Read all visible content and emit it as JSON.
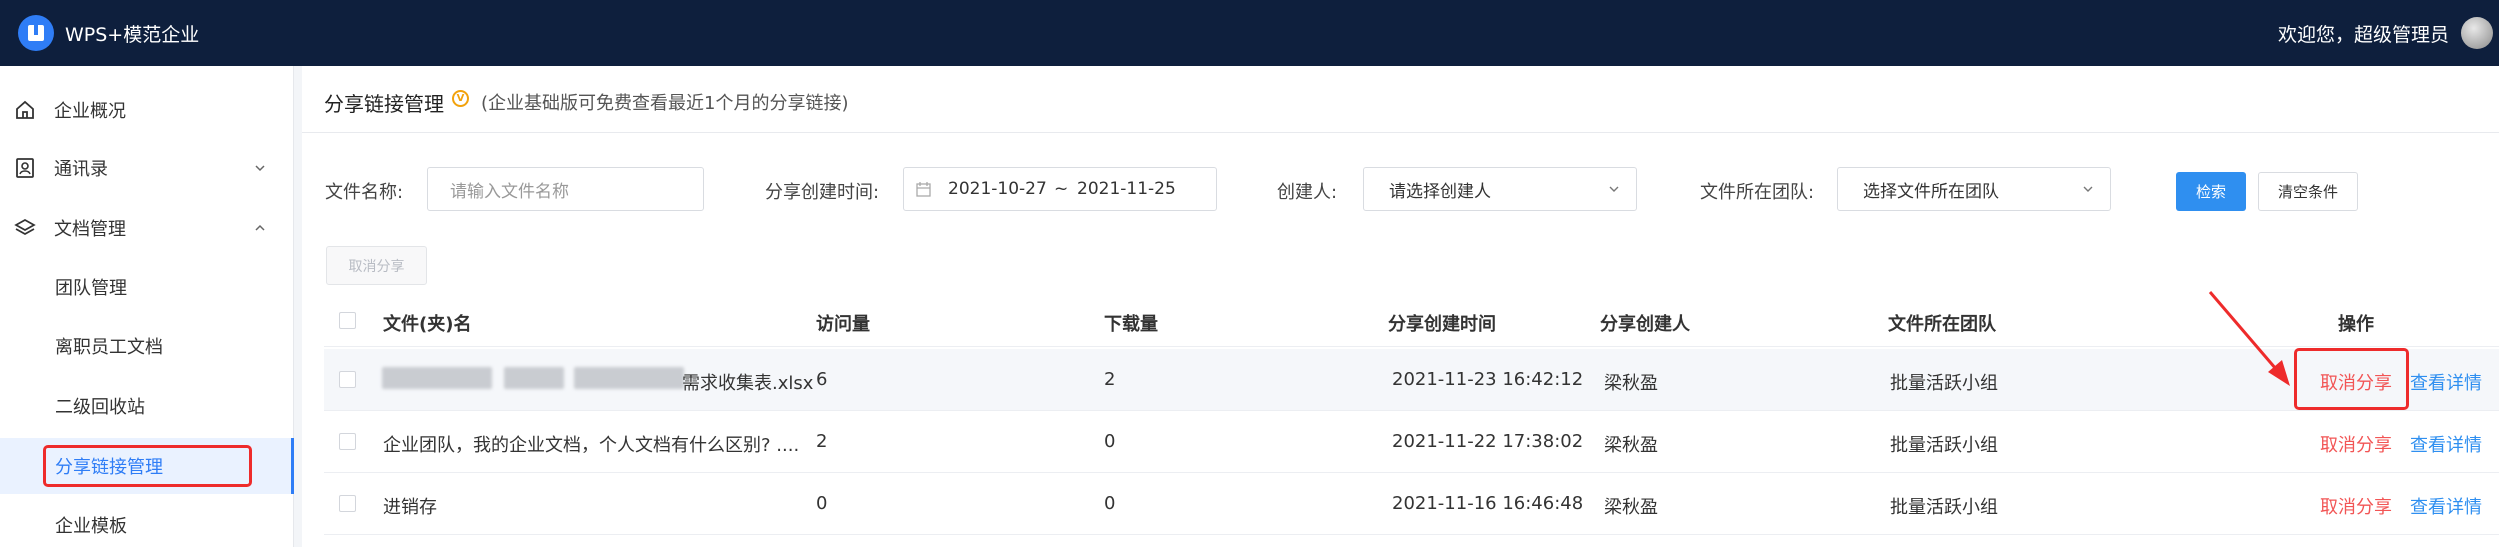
{
  "app": {
    "title": "WPS+模范企业",
    "welcome": "欢迎您，超级管理员"
  },
  "sidebar": {
    "items": [
      {
        "label": "企业概况",
        "icon": "home-icon"
      },
      {
        "label": "通讯录",
        "icon": "contacts-icon"
      },
      {
        "label": "文档管理",
        "icon": "layers-icon"
      }
    ],
    "subitems": [
      {
        "label": "团队管理"
      },
      {
        "label": "离职员工文档"
      },
      {
        "label": "二级回收站"
      },
      {
        "label": "分享链接管理",
        "active": true
      },
      {
        "label": "企业模板"
      }
    ]
  },
  "page": {
    "title": "分享链接管理",
    "note": "(企业基础版可免费查看最近1个月的分享链接)"
  },
  "filters": {
    "file_name_label": "文件名称:",
    "file_name_placeholder": "请输入文件名称",
    "created_time_label": "分享创建时间:",
    "date_start": "2021-10-27",
    "date_sep": "~",
    "date_end": "2021-11-25",
    "creator_label": "创建人:",
    "creator_placeholder": "请选择创建人",
    "team_label": "文件所在团队:",
    "team_placeholder": "选择文件所在团队",
    "search_label": "检索",
    "clear_label": "清空条件"
  },
  "cancel_share_label": "取消分享",
  "table": {
    "columns": [
      "文件(夹)名",
      "访问量",
      "下载量",
      "分享创建时间",
      "分享创建人",
      "文件所在团队",
      "操作"
    ],
    "rows": [
      {
        "name": "需求收集表.xlsx",
        "visits": "6",
        "downloads": "2",
        "created": "2021-11-23 16:42:12",
        "creator": "梁秋盈",
        "team": "批量活跃小组",
        "cancel": "取消分享",
        "detail": "查看详情"
      },
      {
        "name": "企业团队，我的企业文档，个人文档有什么区别? ....",
        "visits": "2",
        "downloads": "0",
        "created": "2021-11-22 17:38:02",
        "creator": "梁秋盈",
        "team": "批量活跃小组",
        "cancel": "取消分享",
        "detail": "查看详情"
      },
      {
        "name": "进销存",
        "visits": "0",
        "downloads": "0",
        "created": "2021-11-16 16:46:48",
        "creator": "梁秋盈",
        "team": "批量活跃小组",
        "cancel": "取消分享",
        "detail": "查看详情"
      }
    ]
  },
  "colors": {
    "topbar": "#0e1f3d",
    "accent": "#2f7df6",
    "danger": "#f25555",
    "annotation": "#ee2b2b"
  }
}
